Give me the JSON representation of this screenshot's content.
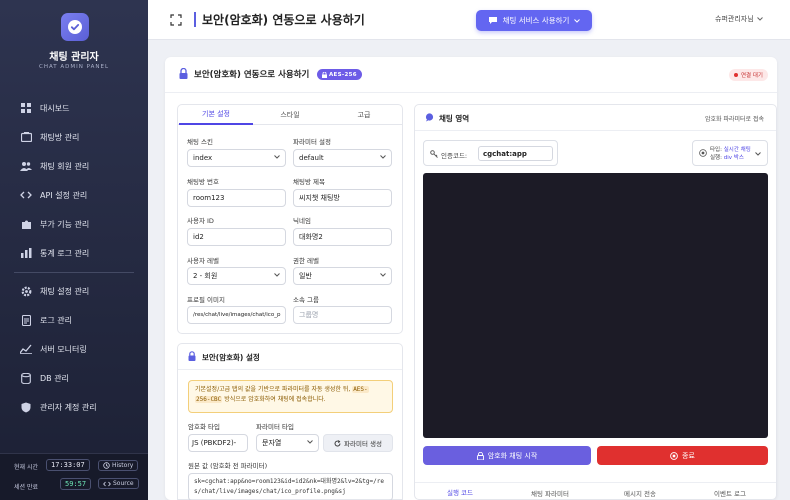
{
  "sidebar": {
    "brand_title": "채팅 관리자",
    "brand_subtitle": "CHAT ADMIN PANEL",
    "items": [
      {
        "label": "대시보드",
        "icon": "dashboard-icon"
      },
      {
        "label": "채팅방 관리",
        "icon": "chat-room-icon"
      },
      {
        "label": "채팅 회원 관리",
        "icon": "users-icon"
      },
      {
        "label": "API 설정 관리",
        "icon": "code-icon"
      },
      {
        "label": "부가 기능 관리",
        "icon": "puzzle-icon"
      },
      {
        "label": "통계 로그 관리",
        "icon": "chart-icon"
      },
      {
        "label": "채팅 설정 관리",
        "icon": "gear-icon"
      },
      {
        "label": "로그 관리",
        "icon": "document-icon"
      },
      {
        "label": "서버 모니터링",
        "icon": "pulse-icon"
      },
      {
        "label": "DB 관리",
        "icon": "database-icon"
      },
      {
        "label": "관리자 계정 관리",
        "icon": "shield-icon"
      }
    ],
    "footer": {
      "time_label": "현재 시간",
      "time_value": "17:33:07",
      "history_label": "History",
      "session_label": "세션 만료",
      "session_value": "59:57",
      "source_label": "Source"
    }
  },
  "topbar": {
    "title": "보안(암호화) 연동으로 사용하기",
    "chat_button": "채팅 서비스 사용하기",
    "user": "슈퍼관리자님"
  },
  "card": {
    "title": "보안(암호화) 연동으로 사용하기",
    "badge": "AES-256",
    "status": "연결 대기"
  },
  "left_panel": {
    "tabs": [
      "기본 설정",
      "스타일",
      "고급"
    ],
    "active_tab": 0,
    "fields": {
      "chat_skin": {
        "label": "채팅 스킨",
        "value": "index"
      },
      "param_setting": {
        "label": "파라미터 설정",
        "value": "default"
      },
      "room_no": {
        "label": "채팅방 번호",
        "value": "room123"
      },
      "room_title": {
        "label": "채팅방 제목",
        "value": "씨지챗 채팅방"
      },
      "user_id": {
        "label": "사용자 ID",
        "value": "id2"
      },
      "nickname": {
        "label": "닉네임",
        "value": "대화명2"
      },
      "user_level": {
        "label": "사용자 레벨",
        "value": "2 - 회원"
      },
      "auth_level": {
        "label": "권한 레벨",
        "value": "일반"
      },
      "profile_image": {
        "label": "프로필 이미지",
        "value": "/res/chat/live/images/chat/ico_p"
      },
      "group": {
        "label": "소속 그룹",
        "placeholder": "그룹명"
      }
    }
  },
  "security_panel": {
    "title": "보안(암호화) 설정",
    "notice_pre": "기본설정/고급 탭의 값을 기반으로 파라미터를 자동 생성한 뒤, ",
    "notice_code1": "AES-",
    "notice_code2": "256-CBC",
    "notice_post": " 방식으로 암호화하여 채팅에 접속합니다.",
    "enc_type_label": "암호화 타입",
    "enc_type_value": "JS (PBKDF2)-",
    "param_type_label": "파라미터 타입",
    "param_type_value": "문자열",
    "generate_button": "파라미터 생성",
    "raw_label": "원본 값 (암호화 전 파라미터)",
    "raw_value": "sk=cgchat:app&no=room123&id=id2&nk=대화명2&lv=2&tg=/res/chat/live/images/chat/ico_profile.png&sj"
  },
  "right_panel": {
    "title": "채팅 영역",
    "link": "암호화 파라미터로 접속",
    "auth_label": "인증코드:",
    "auth_value": "cgchat:app",
    "type_label": "타입:",
    "type_value": "실시간 채팅",
    "size_label": "실행:",
    "size_value": "div 박스",
    "start_button": "암호화 채팅 시작",
    "end_button": "종료",
    "bottom_tabs": [
      "실행 코드",
      "채팅 파라미터",
      "메시지 전송",
      "이벤트 로그"
    ],
    "active_bottom_tab": 0
  },
  "colors": {
    "accent": "#6366f1",
    "sidebar_bg": "#252a40",
    "danger": "#e0302f",
    "preview_bg": "#1c1b26"
  }
}
